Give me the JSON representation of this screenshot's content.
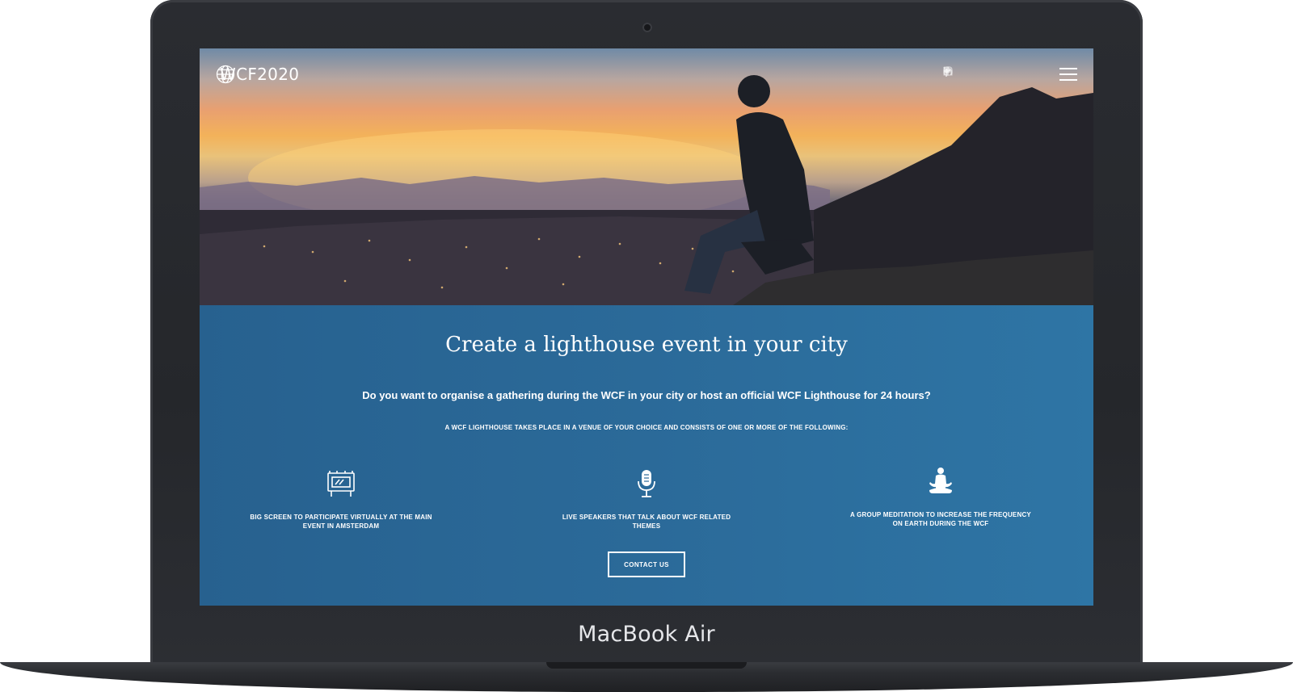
{
  "device": {
    "brand_label": "MacBook Air"
  },
  "site": {
    "logo_text": "WCF2020",
    "logo_icon": "globe-icon",
    "social_icons": [
      "twitter-icon",
      "facebook-icon",
      "linkedin-icon",
      "instagram-icon"
    ],
    "menu_icon": "hamburger-menu-icon"
  },
  "section": {
    "title": "Create a lighthouse event in your city",
    "lead": "Do you want to organise a gathering during the WCF in your city or host an official WCF Lighthouse for 24 hours?",
    "sub": "A WCF LIGHTHOUSE TAKES PLACE IN A VENUE OF YOUR CHOICE AND CONSISTS OF ONE OR MORE OF THE FOLLOWING:",
    "features": [
      {
        "icon": "big-screen-icon",
        "label": "BIG SCREEN TO PARTICIPATE VIRTUALLY AT THE MAIN EVENT IN AMSTERDAM"
      },
      {
        "icon": "microphone-icon",
        "label": "LIVE SPEAKERS THAT TALK ABOUT WCF RELATED THEMES"
      },
      {
        "icon": "meditation-icon",
        "label": "A GROUP MEDITATION TO INCREASE THE FREQUENCY ON EARTH DURING THE WCF"
      }
    ],
    "contact_label": "CONTACT US"
  },
  "colors": {
    "section_bg": "#2b6a99",
    "text": "#ffffff",
    "frame": "#2a2c31"
  }
}
